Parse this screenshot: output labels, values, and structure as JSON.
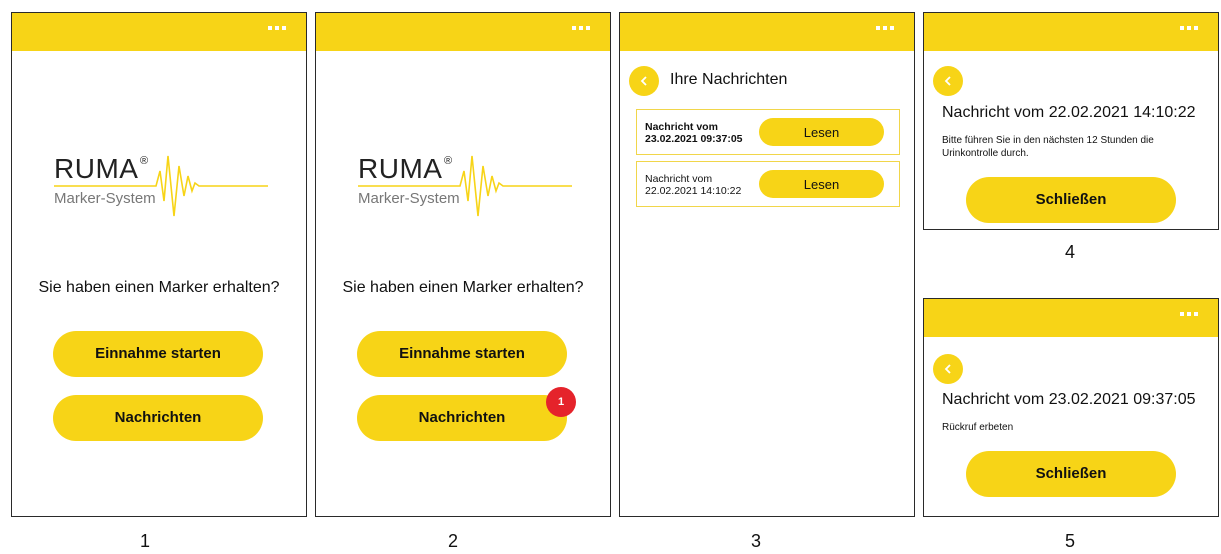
{
  "screens": [
    {
      "number": "1",
      "logo": {
        "brand": "RUMA",
        "registered": "®",
        "subtitle": "Marker-System"
      },
      "question": "Sie haben einen Marker erhalten?",
      "buttons": {
        "intake": "Einnahme starten",
        "messages": "Nachrichten"
      }
    },
    {
      "number": "2",
      "logo": {
        "brand": "RUMA",
        "registered": "®",
        "subtitle": "Marker-System"
      },
      "question": "Sie haben einen Marker erhalten?",
      "buttons": {
        "intake": "Einnahme starten",
        "messages": "Nachrichten"
      },
      "badge_count": "1"
    },
    {
      "number": "3",
      "title": "Ihre Nachrichten",
      "messages": [
        {
          "line1": "Nachricht vom",
          "line2": "23.02.2021 09:37:05",
          "unread": true,
          "action": "Lesen"
        },
        {
          "line1": "Nachricht vom",
          "line2": "22.02.2021 14:10:22",
          "unread": false,
          "action": "Lesen"
        }
      ]
    },
    {
      "number": "4",
      "heading": "Nachricht vom 22.02.2021 14:10:22",
      "body": "Bitte führen Sie in den nächsten 12 Stunden die Urinkontrolle durch.",
      "close": "Schließen"
    },
    {
      "number": "5",
      "heading": "Nachricht vom 23.02.2021 09:37:05",
      "body": "Rückruf erbeten",
      "close": "Schließen"
    }
  ],
  "icons": {
    "menu": "more-dots-icon",
    "back": "chevron-left-icon",
    "logo_wave": "heartbeat-wave-icon"
  },
  "colors": {
    "accent": "#f7d417",
    "badge": "#e5232b",
    "border": "#2a2a2a"
  }
}
